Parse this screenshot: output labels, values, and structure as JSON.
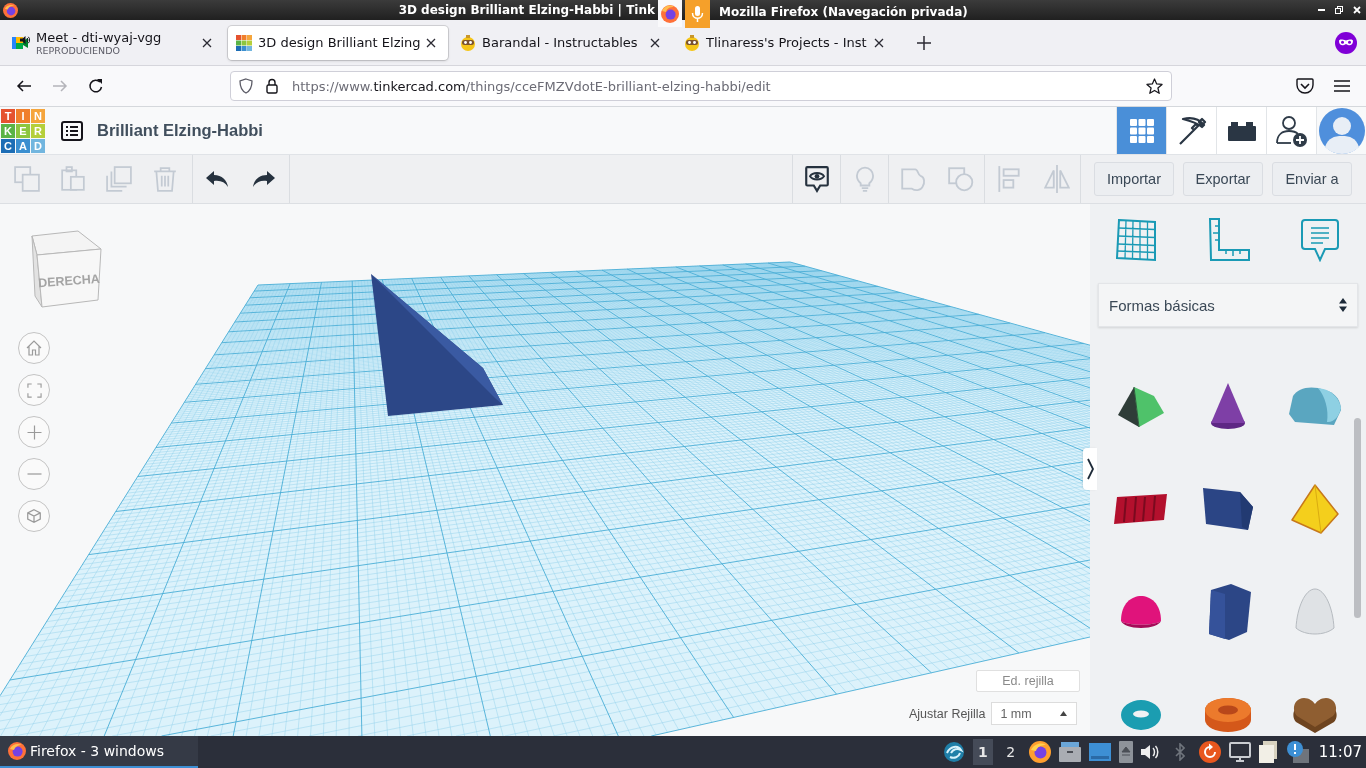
{
  "window": {
    "title_left": "3D design Brilliant Elzing-Habbi | Tink",
    "title_right": "Mozilla Firefox (Navegación privada)"
  },
  "tabs": [
    {
      "title": "Meet - dti-wyaj-vgg",
      "subtitle": "REPRODUCIENDO",
      "playing": true,
      "selected": false
    },
    {
      "title": "3D design Brilliant Elzing",
      "playing": false,
      "selected": true
    },
    {
      "title": "Barandal - Instructables",
      "playing": false,
      "selected": false
    },
    {
      "title": "Tlinaress's Projects - Inst",
      "playing": false,
      "selected": false
    }
  ],
  "navigation": [
    {
      "kind": "back",
      "disabled": false
    },
    {
      "kind": "forward",
      "disabled": true
    },
    {
      "kind": "reload",
      "disabled": false
    }
  ],
  "address_bar": {
    "url_start": "https://www.",
    "url_domain": "tinkercad.com",
    "url_rest": "/things/cceFMZVdotE-brilliant-elzing-habbi/edit"
  },
  "app": {
    "logo": [
      {
        "letter": "T",
        "color": "#e5522f"
      },
      {
        "letter": "I",
        "color": "#f07f2b"
      },
      {
        "letter": "N",
        "color": "#f5a53c"
      },
      {
        "letter": "K",
        "color": "#5bb346"
      },
      {
        "letter": "E",
        "color": "#8dc63f"
      },
      {
        "letter": "R",
        "color": "#b5cf3b"
      },
      {
        "letter": "C",
        "color": "#1c6db5"
      },
      {
        "letter": "A",
        "color": "#3b8fd0"
      },
      {
        "letter": "D",
        "color": "#72b6df"
      }
    ],
    "design_title": "Brilliant Elzing-Habbi",
    "modes": [
      {
        "kind": "grid",
        "selected": true
      },
      {
        "kind": "pickaxe",
        "selected": false
      },
      {
        "kind": "bricks",
        "selected": false
      }
    ]
  },
  "toolbar": {
    "edit_tools": [
      {
        "kind": "copy",
        "disabled": true
      },
      {
        "kind": "paste",
        "disabled": true
      },
      {
        "kind": "duplicate",
        "disabled": true
      },
      {
        "kind": "delete",
        "disabled": true
      }
    ],
    "history": [
      {
        "kind": "undo",
        "disabled": false
      },
      {
        "kind": "redo",
        "disabled": false
      }
    ],
    "view_tools": [
      {
        "kind": "notes",
        "disabled": false
      },
      {
        "kind": "bulb",
        "disabled": true
      },
      {
        "kind": "group",
        "disabled": true
      },
      {
        "kind": "ungroup",
        "disabled": true
      },
      {
        "kind": "align",
        "disabled": true
      },
      {
        "kind": "mirror",
        "disabled": true
      }
    ],
    "actions": [
      "Importar",
      "Exportar",
      "Enviar a"
    ]
  },
  "viewport": {
    "view_cube_label": "DERECHA",
    "controls": [
      {
        "kind": "home"
      },
      {
        "kind": "fit"
      },
      {
        "kind": "zoom_in"
      },
      {
        "kind": "zoom_out"
      },
      {
        "kind": "perspective"
      }
    ],
    "grid_edit_button": "Ed. rejilla",
    "snap_label": "Ajustar Rejilla",
    "snap_value": "1 mm"
  },
  "panel": {
    "tools": [
      {
        "kind": "workplane"
      },
      {
        "kind": "ruler"
      },
      {
        "kind": "notes"
      }
    ],
    "category": "Formas básicas",
    "shapes": [
      {
        "kind": "roof"
      },
      {
        "kind": "cone"
      },
      {
        "kind": "round_roof"
      },
      {
        "kind": "text"
      },
      {
        "kind": "box"
      },
      {
        "kind": "pyramid"
      },
      {
        "kind": "half_sphere"
      },
      {
        "kind": "polygon"
      },
      {
        "kind": "paraboloid"
      },
      {
        "kind": "torus"
      },
      {
        "kind": "tube"
      },
      {
        "kind": "heart"
      }
    ]
  },
  "taskbar": {
    "window_button": "Firefox - 3 windows",
    "workspaces": [
      {
        "label": "1",
        "selected": true
      },
      {
        "label": "2",
        "selected": false
      }
    ],
    "clock": "11:07"
  }
}
